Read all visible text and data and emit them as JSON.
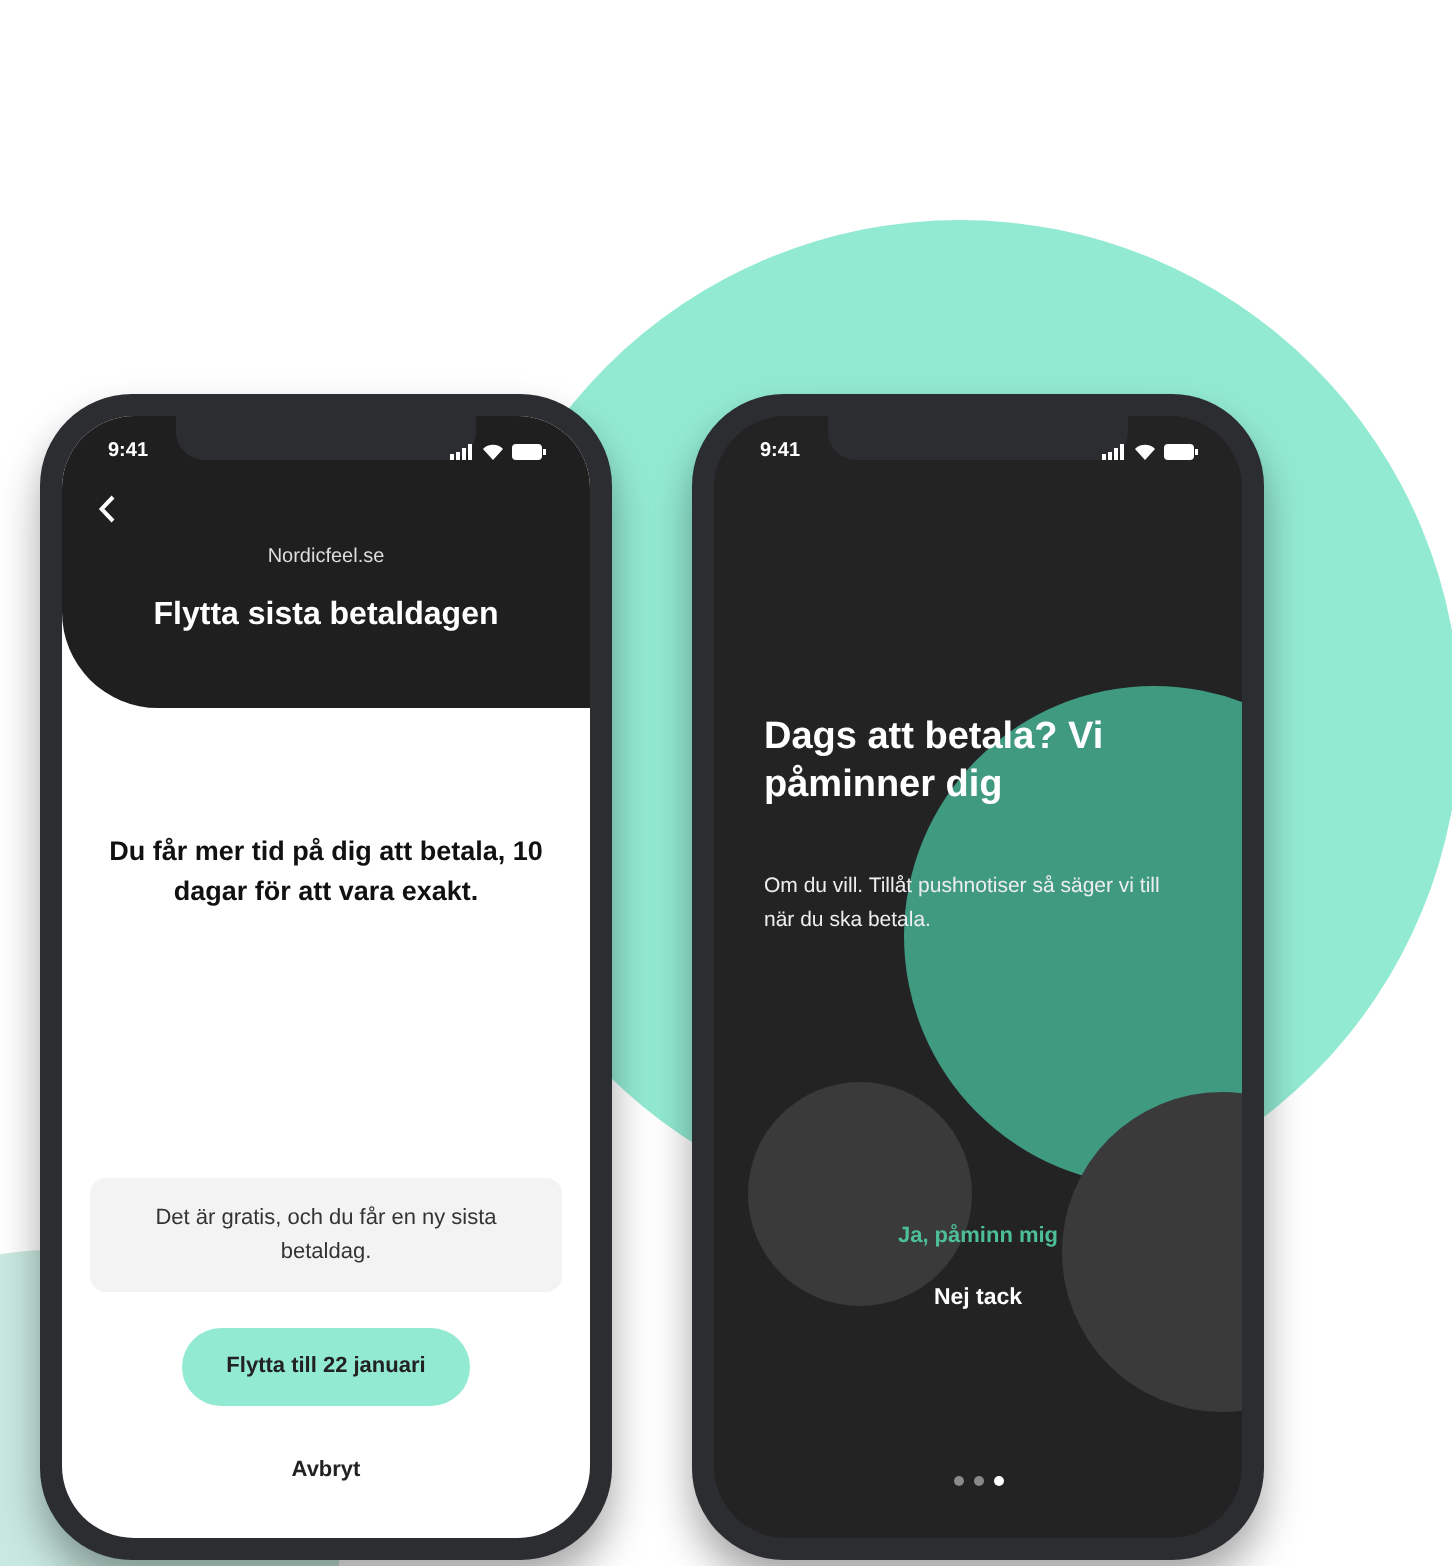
{
  "phones": [
    {
      "kind": "payment-date",
      "status_bar": {
        "time": "9:41"
      },
      "header": {
        "site": "Nordicfeel.se",
        "title": "Flytta sista betaldagen"
      },
      "message": "Du får mer tid på dig att betala, 10 dagar för att vara exakt.",
      "info": "Det är gratis, och du får en ny sista betaldag.",
      "primary_button": "Flytta till 22 januari",
      "cancel_link": "Avbryt"
    },
    {
      "kind": "reminder",
      "status_bar": {
        "time": "9:41"
      },
      "title": "Dags att betala? Vi påminner dig",
      "text": "Om du vill. Tillåt pushnotiser så säger vi till när du ska betala.",
      "accept_link": "Ja, påminn mig",
      "decline_link": "Nej tack",
      "pager": [
        {
          "selected": false
        },
        {
          "selected": false
        },
        {
          "selected": true
        }
      ]
    }
  ]
}
